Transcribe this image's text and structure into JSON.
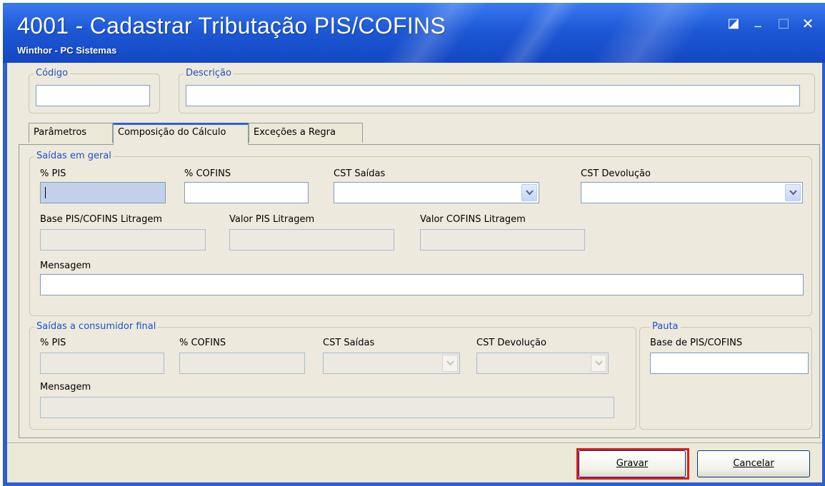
{
  "window": {
    "title": "4001 - Cadastrar Tributação PIS/COFINS",
    "subtitle": "Winthor - PC Sistemas",
    "controls": {
      "restore": "◪",
      "minimize": "_",
      "maximize": "□",
      "close": "✕"
    }
  },
  "header": {
    "codigo_label": "Código",
    "codigo_value": "",
    "descricao_label": "Descrição",
    "descricao_value": ""
  },
  "tabs": [
    {
      "label": "Parâmetros",
      "active": false
    },
    {
      "label": "Composição do Cálculo",
      "active": true
    },
    {
      "label": "Exceções a Regra",
      "active": false
    }
  ],
  "saidas_geral": {
    "legend": "Saídas em geral",
    "pis_label": "% PIS",
    "pis_value": "",
    "cofins_label": "% COFINS",
    "cofins_value": "",
    "cst_saidas_label": "CST Saídas",
    "cst_saidas_value": "",
    "cst_devolucao_label": "CST Devolução",
    "cst_devolucao_value": "",
    "base_litragem_label": "Base PIS/COFINS Litragem",
    "valor_pis_litragem_label": "Valor PIS Litragem",
    "valor_cofins_litragem_label": "Valor COFINS Litragem",
    "mensagem_label": "Mensagem",
    "mensagem_value": ""
  },
  "saidas_consumidor": {
    "legend": "Saídas a consumidor final",
    "pis_label": "% PIS",
    "cofins_label": "% COFINS",
    "cst_saidas_label": "CST Saídas",
    "cst_devolucao_label": "CST Devolução",
    "mensagem_label": "Mensagem"
  },
  "pauta": {
    "legend": "Pauta",
    "base_label": "Base de PIS/COFINS",
    "base_value": ""
  },
  "buttons": {
    "gravar": "Gravar",
    "cancelar": "Cancelar"
  },
  "colors": {
    "titlebar": "#1d58d6",
    "legend_text": "#1f4fc9",
    "focus_field": "#c3d0ec",
    "highlight": "#e0191d"
  },
  "icons": {
    "dropdown": "chevron-down-icon"
  }
}
